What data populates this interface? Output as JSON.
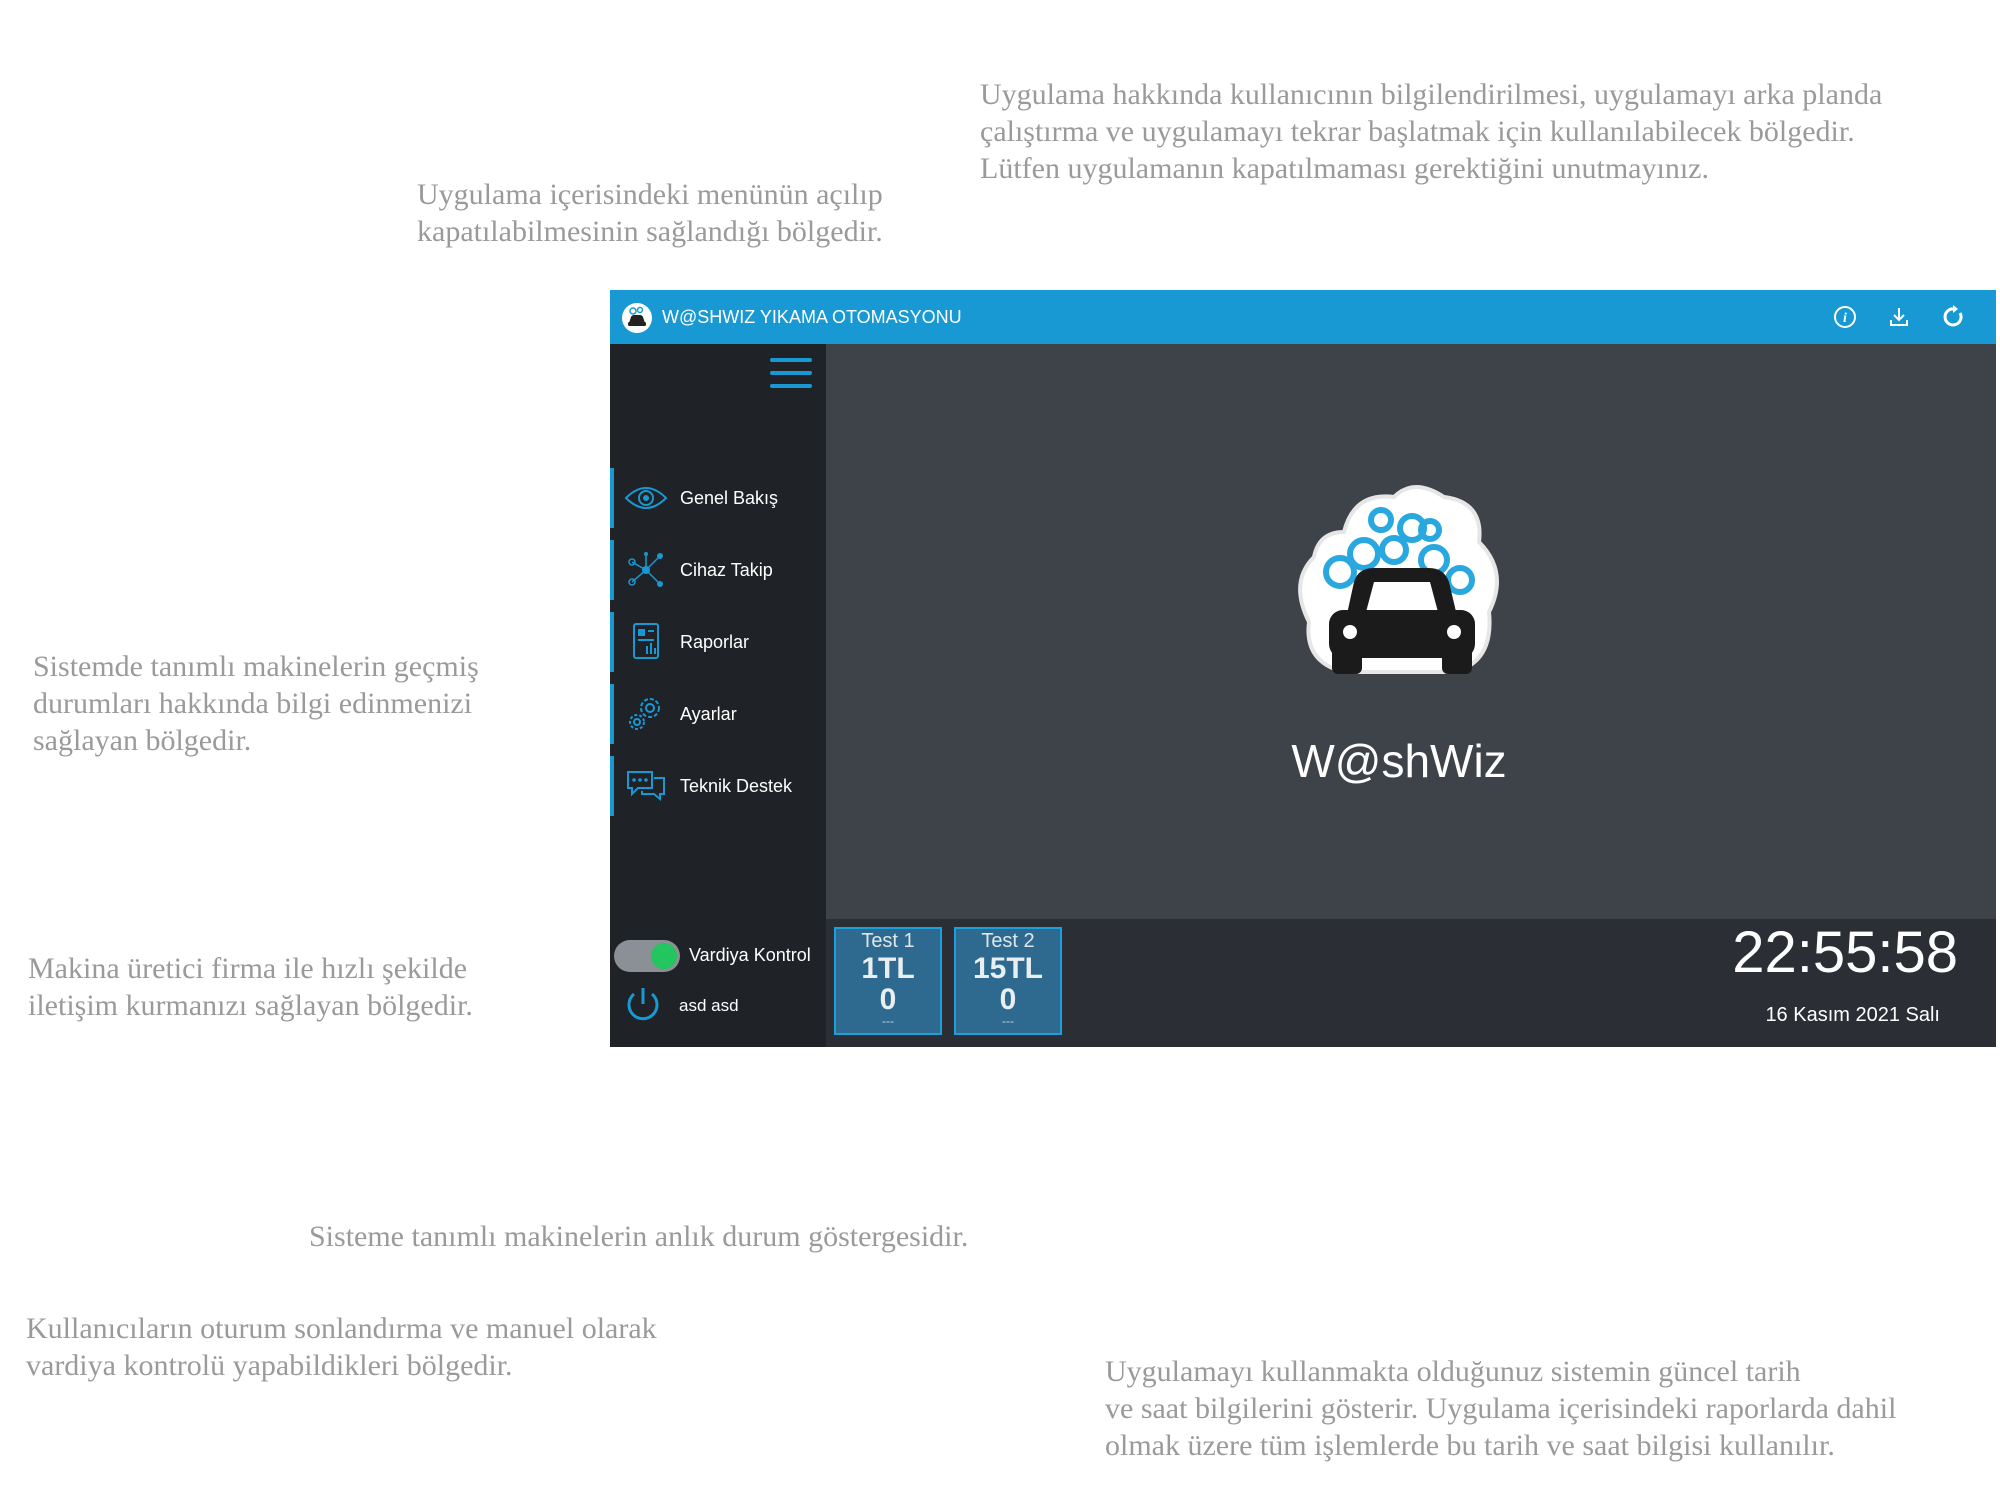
{
  "annotations": {
    "header": "Uygulama hakkında kullanıcının bilgilendirilmesi, uygulamayı arka planda\nçalıştırma ve uygulamayı tekrar başlatmak için kullanılabilecek bölgedir.\nLütfen uygulamanın kapatılmaması gerektiğini unutmayınız.",
    "menu": "Uygulama içerisindeki menünün açılıp\nkapatılabilmesinin sağlandığı bölgedir.",
    "reports": "Sistemde tanımlı makinelerin geçmiş\ndurumları hakkında bilgi edinmenizi\nsağlayan bölgedir.",
    "support": "Makina üretici firma ile hızlı şekilde\niletişim kurmanızı sağlayan bölgedir.",
    "status": "Sisteme tanımlı makinelerin anlık durum göstergesidir.",
    "shift": "Kullanıcıların oturum sonlandırma ve manuel olarak\nvardiya kontrolü yapabildikleri bölgedir.",
    "clock": "Uygulamayı kullanmakta olduğunuz sistemin güncel tarih\nve saat bilgilerini gösterir. Uygulama içerisindeki raporlarda dahil\nolmak üzere tüm işlemlerde bu tarih ve saat bilgisi kullanılır."
  },
  "app": {
    "title": "W@SHWIZ YIKAMA OTOMASYONU",
    "brand_name": "W@shWiz",
    "accent_color": "#1899d3",
    "header_icons": [
      "info-icon",
      "download-icon",
      "restart-icon"
    ]
  },
  "sidebar": {
    "items": [
      {
        "label": "Genel Bakış",
        "icon": "eye-icon"
      },
      {
        "label": "Cihaz Takip",
        "icon": "network-icon"
      },
      {
        "label": "Raporlar",
        "icon": "report-icon"
      },
      {
        "label": "Ayarlar",
        "icon": "gear-icon"
      },
      {
        "label": "Teknik Destek",
        "icon": "chat-icon"
      }
    ],
    "shift_label": "Vardiya Kontrol",
    "shift_on": true,
    "user_name": "asd asd"
  },
  "machines": [
    {
      "name": "Test 1",
      "amount": "1TL",
      "count": "0",
      "extra": "---"
    },
    {
      "name": "Test 2",
      "amount": "15TL",
      "count": "0",
      "extra": "---"
    }
  ],
  "clock": {
    "time": "22:55:58",
    "date": "16 Kasım 2021 Salı"
  }
}
